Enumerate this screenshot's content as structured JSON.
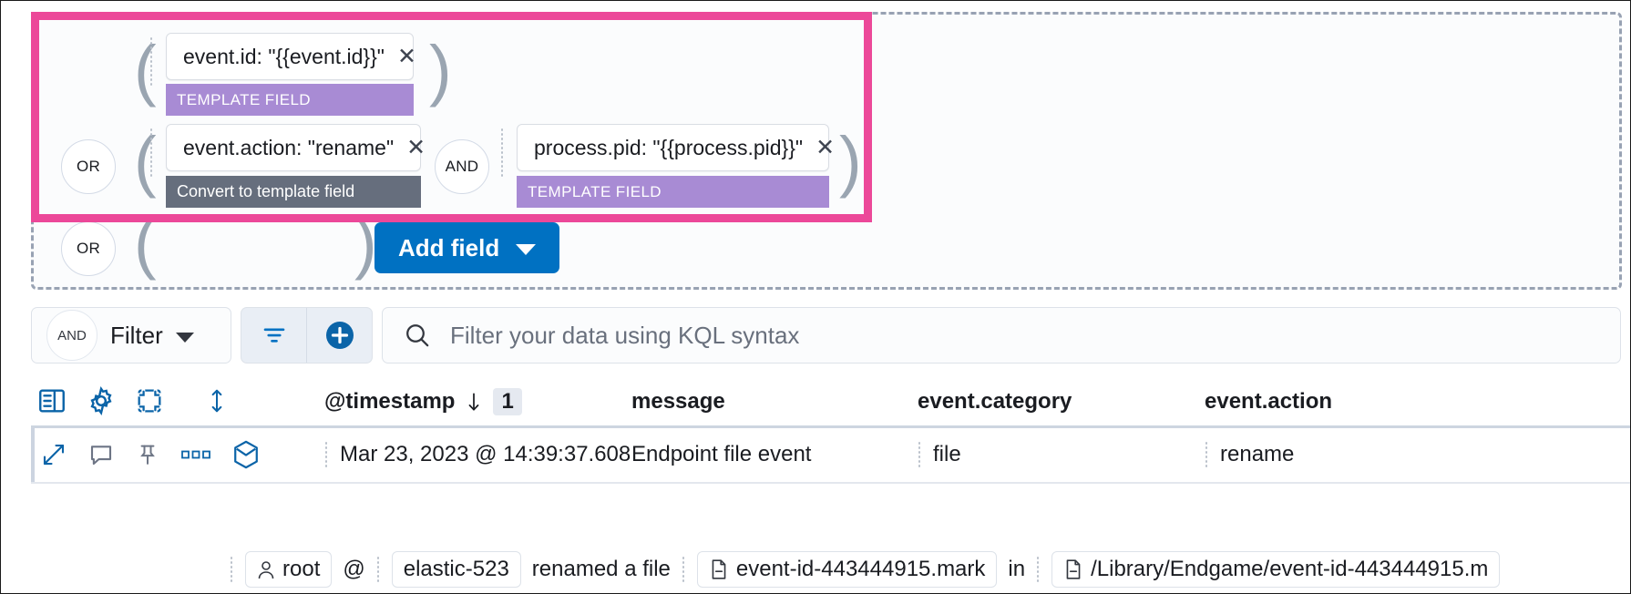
{
  "query_builder": {
    "rows": [
      {
        "paren_open": "(",
        "paren_close": ")",
        "fields": [
          {
            "value": "event.id: \"{{event.id}}\"",
            "remove_icon": "close-icon",
            "badge": "TEMPLATE FIELD",
            "badge_type": "template"
          }
        ]
      },
      {
        "bool": "OR",
        "paren_open": "(",
        "paren_close": ")",
        "joiner": "AND",
        "fields": [
          {
            "value": "event.action: \"rename\"",
            "remove_icon": "close-icon",
            "badge": "Convert to template field",
            "badge_type": "convert"
          },
          {
            "value": "process.pid: \"{{process.pid}}\"",
            "remove_icon": "close-icon",
            "badge": "TEMPLATE FIELD",
            "badge_type": "template"
          }
        ]
      },
      {
        "bool": "OR",
        "paren_open": "(",
        "paren_close": ")",
        "fields": []
      }
    ],
    "add_field_label": "Add field",
    "add_field_chevron": "chevron-down-icon",
    "highlight_color": "#ec4899",
    "template_badge_color": "#a88bd4",
    "convert_badge_color": "#666e7d",
    "add_field_color": "#0071c2"
  },
  "filter_bar": {
    "filter_group": {
      "bool": "AND",
      "label": "Filter",
      "chevron": "chevron-down-icon"
    },
    "icon_buttons": [
      {
        "name": "filter-options-icon"
      },
      {
        "name": "add-filter-icon"
      }
    ],
    "search": {
      "icon": "search-icon",
      "placeholder": "Filter your data using KQL syntax",
      "value": ""
    }
  },
  "data_grid": {
    "toolbar_icons": [
      {
        "name": "columns-panel-icon"
      },
      {
        "name": "gear-icon"
      },
      {
        "name": "fullscreen-icon"
      },
      {
        "name": "sort-updown-icon"
      }
    ],
    "columns": [
      {
        "label": "@timestamp",
        "sort_icon": "arrow-down-icon",
        "sort_order": "1"
      },
      {
        "label": "message"
      },
      {
        "label": "event.category"
      },
      {
        "label": "event.action"
      }
    ],
    "rows": [
      {
        "actions": [
          {
            "name": "expand-icon"
          },
          {
            "name": "comment-icon"
          },
          {
            "name": "pin-icon"
          },
          {
            "name": "more-icon"
          },
          {
            "name": "cube-icon"
          }
        ],
        "timestamp": "Mar 23, 2023 @ 14:39:37.608",
        "message": "Endpoint file event",
        "event_category": "file",
        "event_action": "rename"
      }
    ],
    "bottom_row": {
      "user_icon": "user-icon",
      "user": "root",
      "at": "@",
      "host": "elastic-523",
      "action_text": "renamed a file",
      "file_icon": "file-icon",
      "file": "event-id-443444915.mark",
      "preposition": "in",
      "path_icon": "file-icon",
      "path": "/Library/Endgame/event-id-443444915.m"
    }
  }
}
